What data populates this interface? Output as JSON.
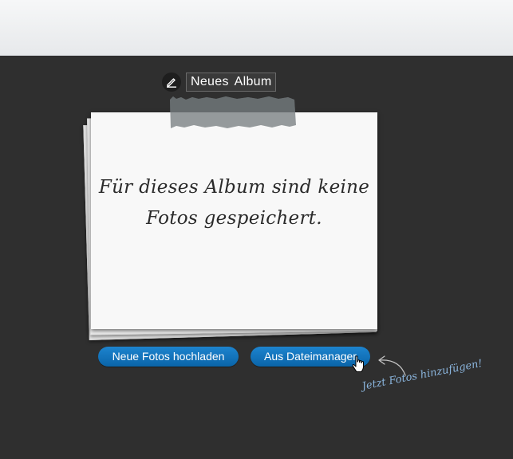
{
  "album": {
    "name": "Neues Album"
  },
  "empty_state": {
    "message": "Für dieses Album sind keine Fotos gespeichert."
  },
  "actions": {
    "upload_label": "Neue Fotos hochladen",
    "filemanager_label": "Aus Dateimanager"
  },
  "hint": {
    "text": "Jetzt Fotos hinzufügen!"
  },
  "icons": {
    "edit": "pencil-icon",
    "cursor": "hand-pointer-icon",
    "arrow": "curved-arrow-icon"
  },
  "colors": {
    "background": "#2f2f2f",
    "header": "#eceef0",
    "button": "#1d7cc6",
    "hint": "#8ab4dc",
    "paper": "#f8f8f8"
  }
}
